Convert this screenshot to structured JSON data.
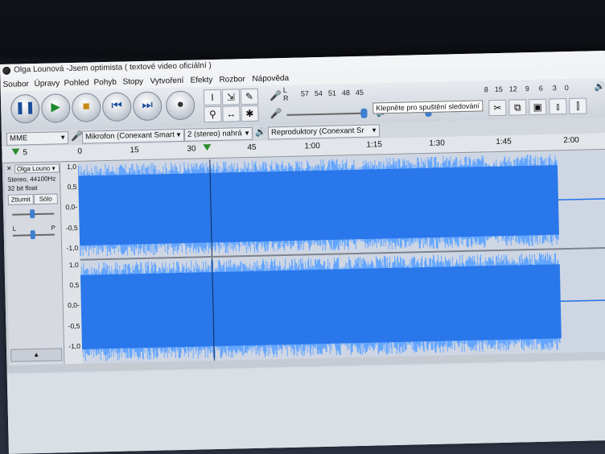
{
  "window": {
    "title": "Olga Lounová -Jsem optimista ( textové video oficiální )"
  },
  "menu": [
    "Soubor",
    "Úpravy",
    "Pohled",
    "Pohyb",
    "Stopy",
    "Vytvoření",
    "Efekty",
    "Rozbor",
    "Nápověda"
  ],
  "meter": {
    "scale": [
      "57",
      "54",
      "51",
      "48",
      "45",
      "8",
      "15",
      "12",
      "9",
      "6",
      "3",
      "0"
    ],
    "lr": [
      "L",
      "R"
    ],
    "tooltip": "Klepněte pro spuštění sledování"
  },
  "devices": {
    "host": "MME",
    "mic": "Mikrofon (Conexant Smart",
    "channels": "2 (stereo) nahrá",
    "speakers": "Reproduktory (Conexant Sr"
  },
  "timeline": {
    "labels": [
      "5",
      "0",
      "15",
      "30",
      "45",
      "1:00",
      "1:15",
      "1:30",
      "1:45",
      "2:00"
    ]
  },
  "track": {
    "name": "Olga Louno",
    "info1": "Stereo, 44100Hz",
    "info2": "32 bit float",
    "mute": "Ztlumit",
    "solo": "Sólo",
    "pan_l": "L",
    "pan_r": "P"
  },
  "vruler": {
    "labels": [
      "1,0",
      "0,5",
      "0,0-",
      "-0,5",
      "-1,0"
    ]
  },
  "colors": {
    "wave": "#1f6fe6",
    "wave_light": "#64a6ff",
    "wave_bg": "#cfd6e3"
  }
}
